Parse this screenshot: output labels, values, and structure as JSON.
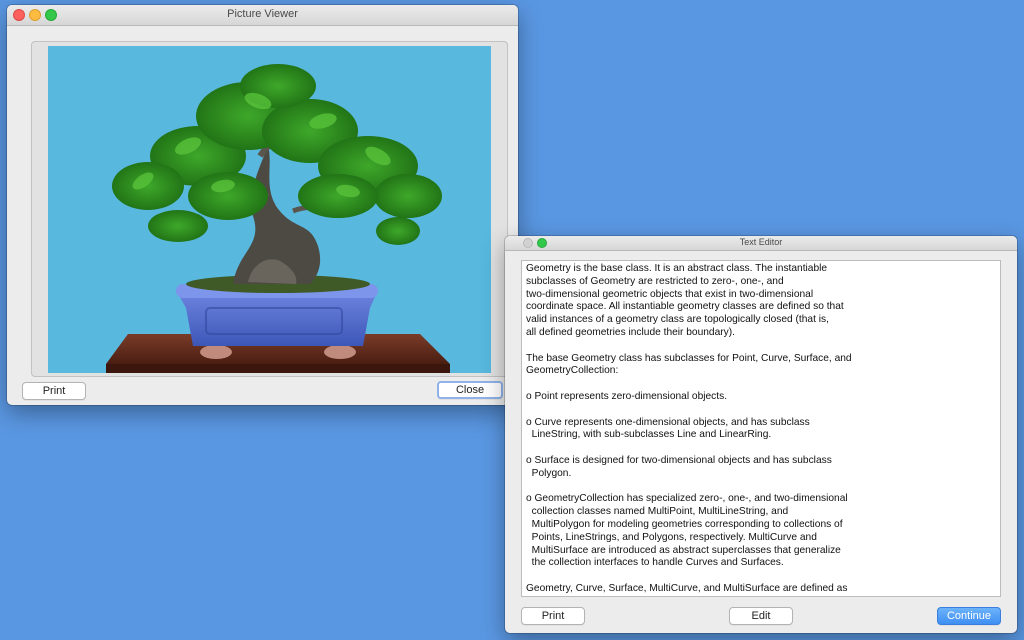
{
  "picture_viewer": {
    "title": "Picture Viewer",
    "print_label": "Print",
    "close_label": "Close"
  },
  "text_editor": {
    "title": "Text Editor",
    "body": "Geometry is the base class. It is an abstract class. The instantiable\nsubclasses of Geometry are restricted to zero-, one-, and\ntwo-dimensional geometric objects that exist in two-dimensional\ncoordinate space. All instantiable geometry classes are defined so that\nvalid instances of a geometry class are topologically closed (that is,\nall defined geometries include their boundary).\n\nThe base Geometry class has subclasses for Point, Curve, Surface, and\nGeometryCollection:\n\no Point represents zero-dimensional objects.\n\no Curve represents one-dimensional objects, and has subclass\n  LineString, with sub-subclasses Line and LinearRing.\n\no Surface is designed for two-dimensional objects and has subclass\n  Polygon.\n\no GeometryCollection has specialized zero-, one-, and two-dimensional\n  collection classes named MultiPoint, MultiLineString, and\n  MultiPolygon for modeling geometries corresponding to collections of\n  Points, LineStrings, and Polygons, respectively. MultiCurve and\n  MultiSurface are introduced as abstract superclasses that generalize\n  the collection interfaces to handle Curves and Surfaces.\n\nGeometry, Curve, Surface, MultiCurve, and MultiSurface are defined as",
    "print_label": "Print",
    "edit_label": "Edit",
    "continue_label": "Continue"
  },
  "colors": {
    "desktop": "#5a97e2",
    "accent": "#3f8ff4",
    "focus_ring": "#8fb2e9"
  }
}
